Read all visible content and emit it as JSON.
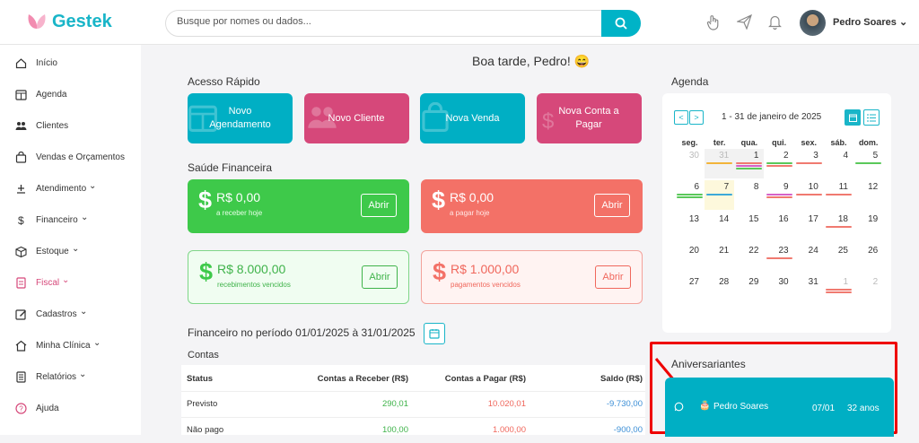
{
  "app": {
    "name": "Gestek"
  },
  "header": {
    "search": {
      "placeholder": "Busque por nomes ou dados...",
      "value": ""
    },
    "user": {
      "name": "Pedro Soares"
    },
    "icons": [
      "hand-icon",
      "send-icon",
      "bell-icon"
    ]
  },
  "sidebar": {
    "items": [
      {
        "label": "Início",
        "icon": "home-icon",
        "arrow": ""
      },
      {
        "label": "Agenda",
        "icon": "calendar-icon",
        "arrow": ""
      },
      {
        "label": "Clientes",
        "icon": "users-icon",
        "arrow": ""
      },
      {
        "label": "Vendas e Orçamentos",
        "icon": "shopping-bag-icon",
        "arrow": ""
      },
      {
        "label": "Atendimento",
        "icon": "service-icon",
        "arrow": "⌄"
      },
      {
        "label": "Financeiro",
        "icon": "dollar-icon",
        "arrow": "⌄"
      },
      {
        "label": "Estoque",
        "icon": "box-icon",
        "arrow": "⌄"
      },
      {
        "label": "Fiscal",
        "icon": "document-icon",
        "arrow": "⌄",
        "active": true
      },
      {
        "label": "Cadastros",
        "icon": "edit-icon",
        "arrow": "⌄"
      },
      {
        "label": "Minha Clínica",
        "icon": "clinic-icon",
        "arrow": "⌄"
      },
      {
        "label": "Relatórios",
        "icon": "report-icon",
        "arrow": "⌄"
      },
      {
        "label": "Ajuda",
        "icon": "help-icon",
        "arrow": ""
      }
    ]
  },
  "main": {
    "greeting": "Boa tarde, Pedro! 😄",
    "quick_access": {
      "title": "Acesso Rápido",
      "buttons": [
        {
          "label": "Novo Agendamento",
          "color": "#00afc4",
          "icon": "calendar-icon"
        },
        {
          "label": "Novo Cliente",
          "color": "#d6487a",
          "icon": "users-icon"
        },
        {
          "label": "Nova Venda",
          "color": "#00afc4",
          "icon": "shopping-bag-icon"
        },
        {
          "label": "Nova Conta a Pagar",
          "color": "#d6487a",
          "icon": "dollar-icon"
        }
      ]
    },
    "financial_health": {
      "title": "Saúde Financeira",
      "cards": [
        {
          "value": "R$ 0,00",
          "sub": "a receber hoje",
          "button": "Abrir"
        },
        {
          "value": "R$ 0,00",
          "sub": "a pagar hoje",
          "button": "Abrir"
        },
        {
          "value": "R$ 8.000,00",
          "sub": "recebimentos vencidos",
          "button": "Abrir"
        },
        {
          "value": "R$ 1.000,00",
          "sub": "pagamentos vencidos",
          "button": "Abrir"
        }
      ]
    },
    "period": {
      "title": "Financeiro no período 01/01/2025 à 31/01/2025"
    },
    "accounts": {
      "title": "Contas",
      "headers": [
        "Status",
        "Contas a Receber (R$)",
        "Contas a Pagar (R$)",
        "Saldo (R$)"
      ],
      "rows": [
        [
          "Previsto",
          "290,01",
          "10.020,01",
          "-9.730,00"
        ],
        [
          "Não pago",
          "100,00",
          "1.000,00",
          "-900,00"
        ]
      ]
    },
    "agenda": {
      "title": "Agenda",
      "range": "1 - 31 de janeiro de 2025",
      "prev": "<",
      "next": ">",
      "weekdays": [
        "seg.",
        "ter.",
        "qua.",
        "qui.",
        "sex.",
        "sáb.",
        "dom."
      ],
      "weeks": [
        [
          "30",
          "31",
          "1",
          "2",
          "3",
          "4",
          "5"
        ],
        [
          "6",
          "7",
          "8",
          "9",
          "10",
          "11",
          "12"
        ],
        [
          "13",
          "14",
          "15",
          "16",
          "17",
          "18",
          "19"
        ],
        [
          "20",
          "21",
          "22",
          "23",
          "24",
          "25",
          "26"
        ],
        [
          "27",
          "28",
          "29",
          "30",
          "31",
          "1",
          "2"
        ]
      ]
    },
    "birthdays": {
      "title": "Aniversariantes",
      "entries": [
        {
          "name": "Pedro Soares",
          "date": "07/01",
          "age": "32 anos"
        }
      ]
    }
  }
}
